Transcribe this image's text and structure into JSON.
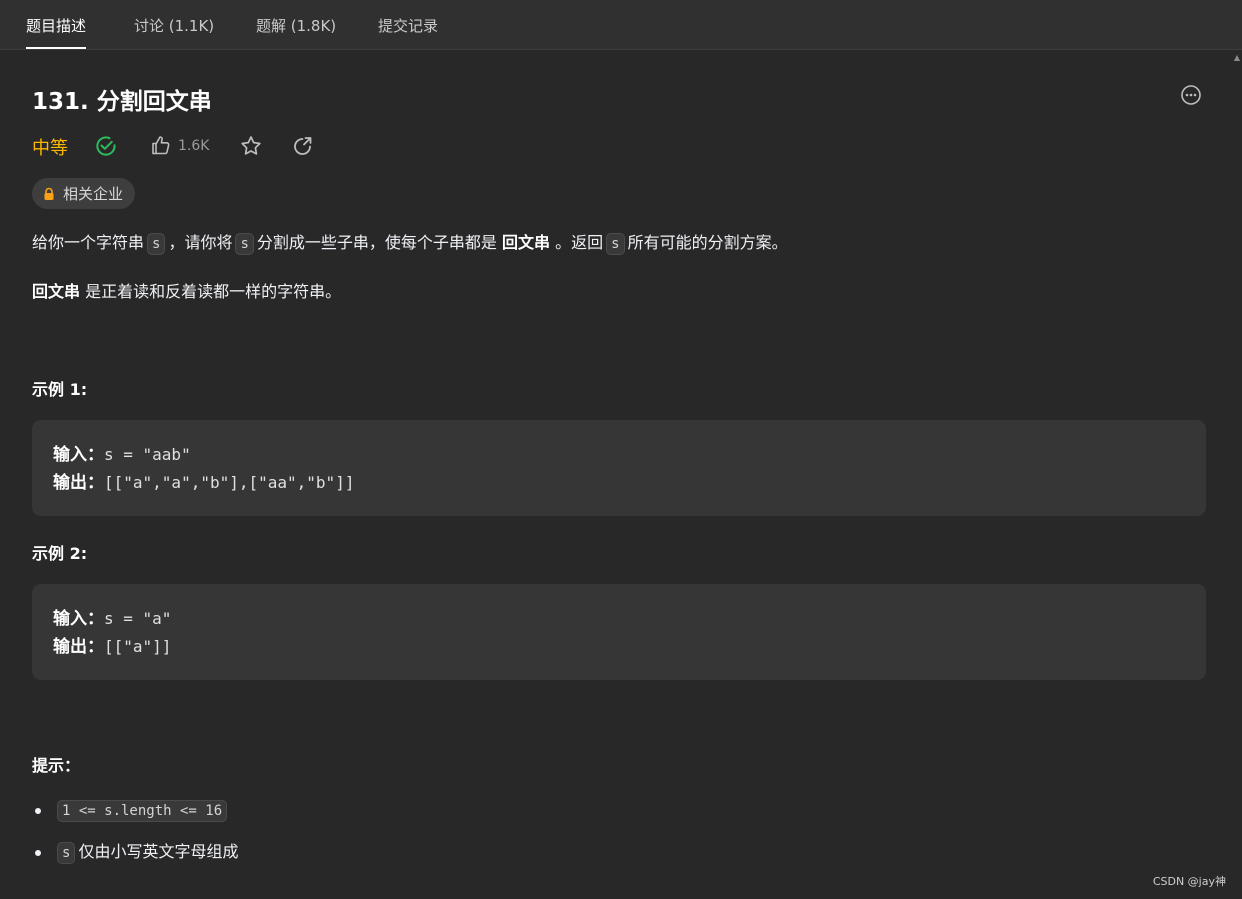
{
  "tabs": [
    {
      "label": "题目描述",
      "active": true
    },
    {
      "label": "讨论 (1.1K)",
      "active": false
    },
    {
      "label": "题解 (1.8K)",
      "active": false
    },
    {
      "label": "提交记录",
      "active": false
    }
  ],
  "problem": {
    "title": "131. 分割回文串",
    "difficulty": "中等",
    "likes": "1.6K",
    "company_tag": "相关企业",
    "description": {
      "p1_a": "给你一个字符串",
      "p1_code1": "s",
      "p1_b": "，请你将",
      "p1_code2": "s",
      "p1_c": "分割成一些子串，使每个子串都是",
      "p1_bold": "回文串",
      "p1_d": "。返回",
      "p1_code3": "s",
      "p1_e": "所有可能的分割方案。",
      "p2_bold": "回文串",
      "p2_rest": "是正着读和反着读都一样的字符串。"
    },
    "examples": [
      {
        "title": "示例 1:",
        "input_label": "输入：",
        "input": "s = \"aab\"",
        "output_label": "输出：",
        "output": "[[\"a\",\"a\",\"b\"],[\"aa\",\"b\"]]"
      },
      {
        "title": "示例 2:",
        "input_label": "输入：",
        "input": "s = \"a\"",
        "output_label": "输出：",
        "output": "[[\"a\"]]"
      }
    ],
    "hints_title": "提示：",
    "constraints": [
      {
        "code": "1 <= s.length <= 16",
        "text": ""
      },
      {
        "code": "s",
        "text": "仅由小写英文字母组成"
      }
    ]
  },
  "watermark": "CSDN @jay神",
  "colors": {
    "medium": "#ffb800",
    "solved": "#2cbb5d",
    "lock": "#ffa116"
  },
  "icons": [
    "more-icon",
    "solved-check-icon",
    "thumbs-up-icon",
    "star-icon",
    "share-icon",
    "lock-icon"
  ]
}
